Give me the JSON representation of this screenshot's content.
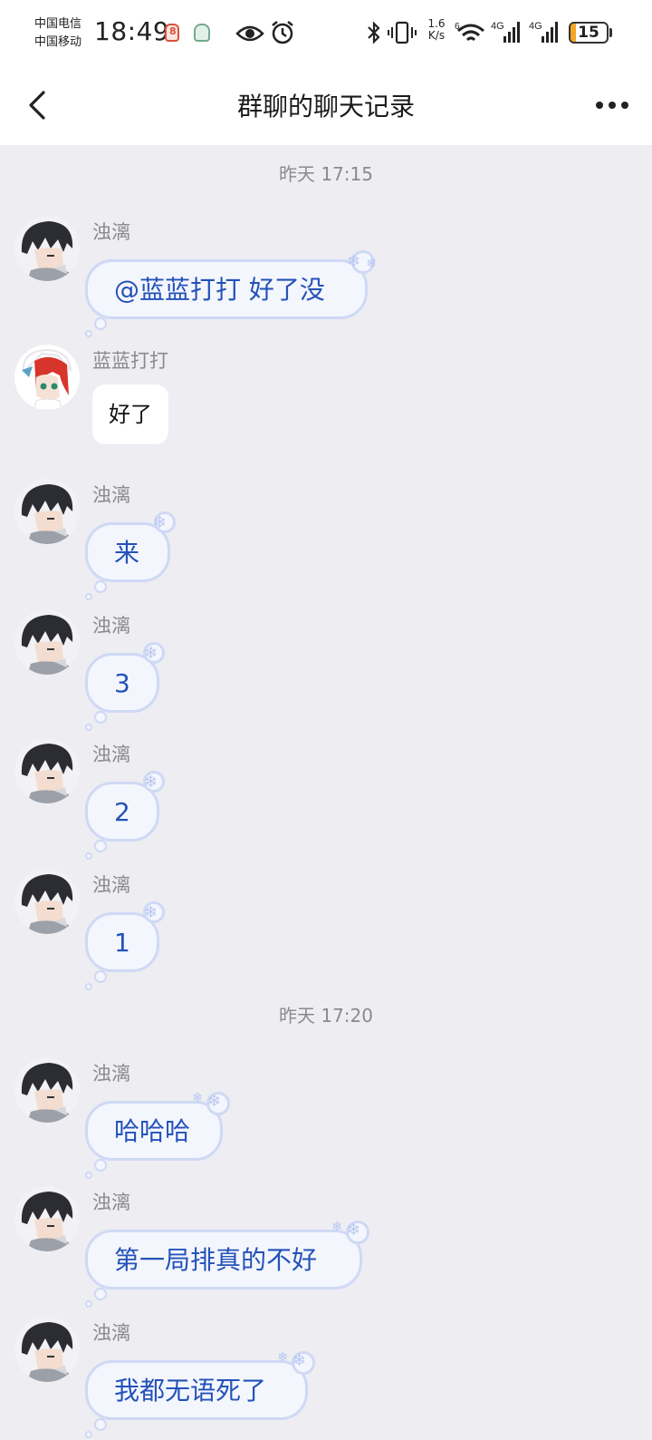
{
  "status_bar": {
    "carrier_1": "中国电信",
    "carrier_2": "中国移动",
    "time": "18:49",
    "net_speed_value": "1.6",
    "net_speed_unit": "K/s",
    "signal_1_label": "4G",
    "signal_2_label": "4G",
    "wifi_label": "6",
    "battery_level": "15",
    "battery_fraction": 0.15,
    "battery_color": "#f5a623"
  },
  "header": {
    "title": "群聊的聊天记录",
    "back_icon": "chevron-left-icon",
    "more_icon": "more-dots-icon"
  },
  "chat": {
    "timestamps": [
      "昨天 17:15",
      "昨天 17:20"
    ],
    "messages": [
      {
        "sender": "浊漓",
        "text": "@蓝蓝打打 好了没",
        "style": "cloud"
      },
      {
        "sender": "蓝蓝打打",
        "text": "好了",
        "style": "white"
      },
      {
        "sender": "浊漓",
        "text": "来",
        "style": "cloud"
      },
      {
        "sender": "浊漓",
        "text": "3",
        "style": "cloud"
      },
      {
        "sender": "浊漓",
        "text": "2",
        "style": "cloud"
      },
      {
        "sender": "浊漓",
        "text": "1",
        "style": "cloud"
      },
      {
        "sender": "浊漓",
        "text": "哈哈哈",
        "style": "cloud"
      },
      {
        "sender": "浊漓",
        "text": "第一局排真的不好",
        "style": "cloud"
      },
      {
        "sender": "浊漓",
        "text": "我都无语死了",
        "style": "cloud"
      }
    ]
  },
  "colors": {
    "background": "#ededf2",
    "bubble_text": "#2452b8",
    "bubble_border": "#cfd9f5",
    "meta_text": "#8a8a8f"
  }
}
